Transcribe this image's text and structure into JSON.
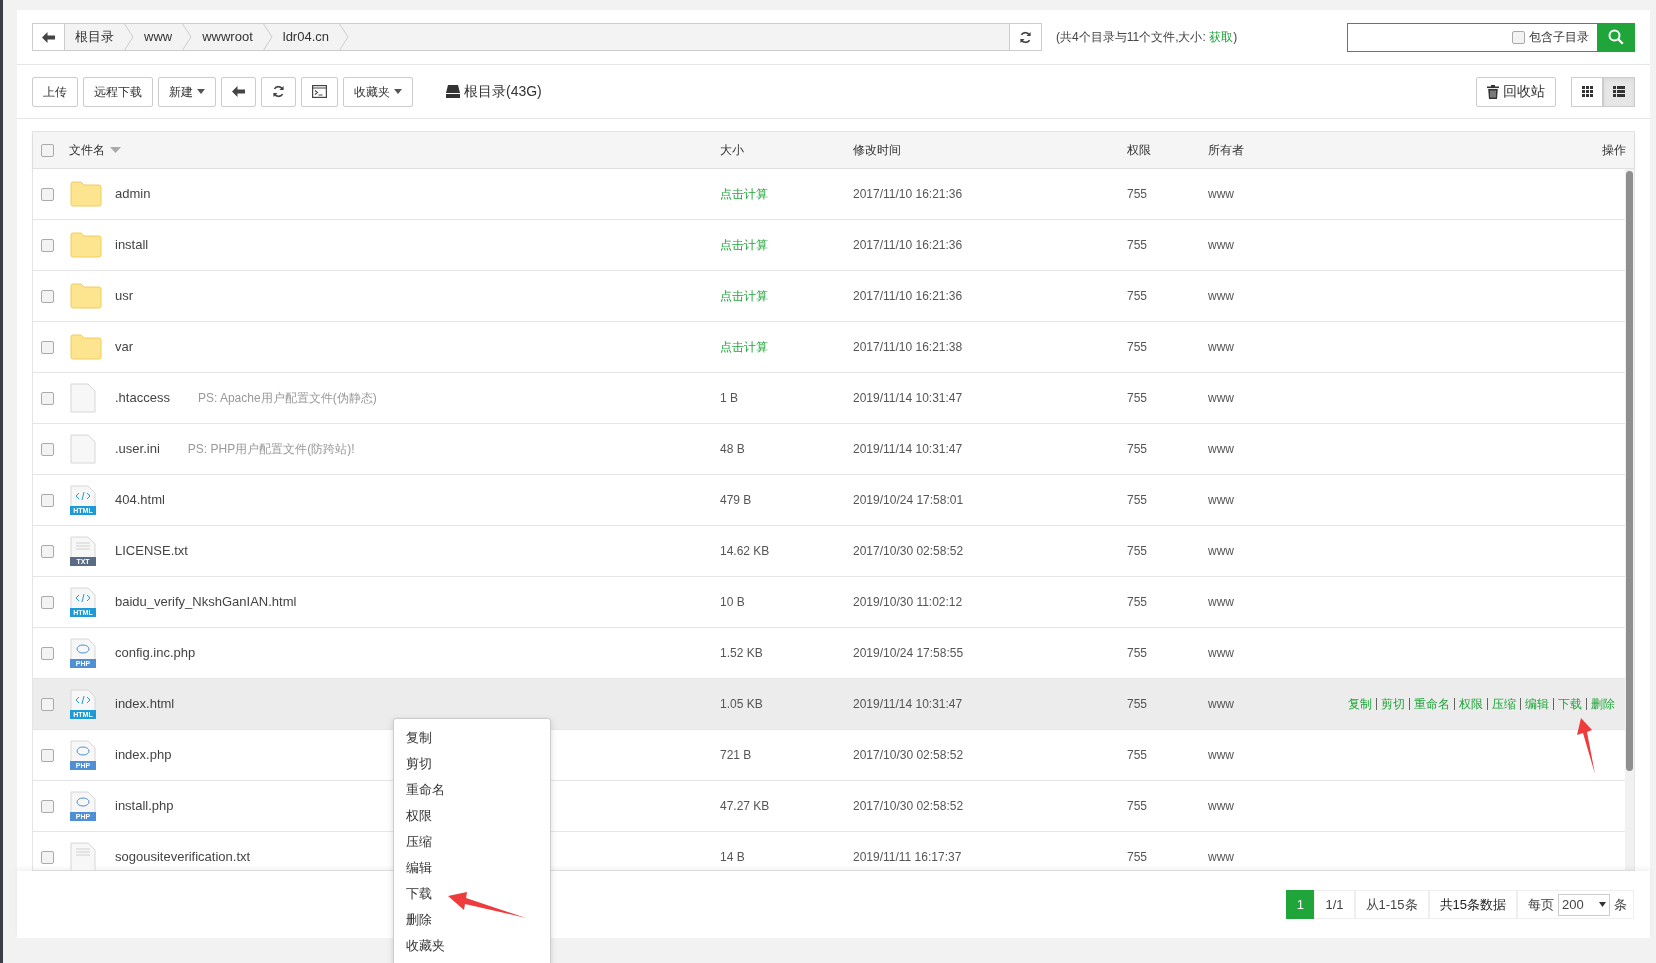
{
  "breadcrumb": {
    "items": [
      "根目录",
      "www",
      "wwwroot",
      "ldr04.cn"
    ]
  },
  "summary": {
    "text": "(共4个目录与11个文件,大小:",
    "link": "获取",
    "close": ")"
  },
  "search": {
    "include_subdirs": {
      "label": "包含子目录",
      "checked": false
    }
  },
  "toolbar": {
    "buttons": [
      {
        "kind": "text",
        "label": "上传"
      },
      {
        "kind": "text",
        "label": "远程下载"
      },
      {
        "kind": "dropdown",
        "label": "新建"
      },
      {
        "kind": "back"
      },
      {
        "kind": "refresh"
      },
      {
        "kind": "terminal"
      },
      {
        "kind": "dropdown",
        "label": "收藏夹"
      }
    ],
    "disk": "根目录(43G)",
    "recycle": "回收站",
    "views": [
      {
        "kind": "grid",
        "selected": false
      },
      {
        "kind": "list",
        "selected": true
      }
    ]
  },
  "table": {
    "select_all_checked": false,
    "columns": [
      "文件名",
      "大小",
      "修改时间",
      "权限",
      "所有者",
      "操作"
    ],
    "rows": [
      {
        "kind": "folder",
        "name": "admin",
        "size": "点击计算",
        "size_is_link": true,
        "modified": "2017/11/10 16:21:36",
        "perm": "755",
        "owner": "www",
        "checked": false,
        "highlighted": false
      },
      {
        "kind": "folder",
        "name": "install",
        "size": "点击计算",
        "size_is_link": true,
        "modified": "2017/11/10 16:21:36",
        "perm": "755",
        "owner": "www",
        "checked": false,
        "highlighted": false
      },
      {
        "kind": "folder",
        "name": "usr",
        "size": "点击计算",
        "size_is_link": true,
        "modified": "2017/11/10 16:21:36",
        "perm": "755",
        "owner": "www",
        "checked": false,
        "highlighted": false
      },
      {
        "kind": "folder",
        "name": "var",
        "size": "点击计算",
        "size_is_link": true,
        "modified": "2017/11/10 16:21:38",
        "perm": "755",
        "owner": "www",
        "checked": false,
        "highlighted": false
      },
      {
        "kind": "blank",
        "name": ".htaccess",
        "note": "PS: Apache用户配置文件(伪静态)",
        "size": "1 B",
        "size_is_link": false,
        "modified": "2019/11/14 10:31:47",
        "perm": "755",
        "owner": "www",
        "checked": false,
        "highlighted": false
      },
      {
        "kind": "blank",
        "name": ".user.ini",
        "note": "PS: PHP用户配置文件(防跨站)!",
        "size": "48 B",
        "size_is_link": false,
        "modified": "2019/11/14 10:31:47",
        "perm": "755",
        "owner": "www",
        "checked": false,
        "highlighted": false
      },
      {
        "kind": "html",
        "icon_label": "HTML",
        "name": "404.html",
        "size": "479 B",
        "size_is_link": false,
        "modified": "2019/10/24 17:58:01",
        "perm": "755",
        "owner": "www",
        "checked": false,
        "highlighted": false
      },
      {
        "kind": "txt",
        "icon_label": "TXT",
        "name": "LICENSE.txt",
        "size": "14.62 KB",
        "size_is_link": false,
        "modified": "2017/10/30 02:58:52",
        "perm": "755",
        "owner": "www",
        "checked": false,
        "highlighted": false
      },
      {
        "kind": "html",
        "icon_label": "HTML",
        "name": "baidu_verify_NkshGanIAN.html",
        "size": "10 B",
        "size_is_link": false,
        "modified": "2019/10/30 11:02:12",
        "perm": "755",
        "owner": "www",
        "checked": false,
        "highlighted": false
      },
      {
        "kind": "php",
        "icon_label": "PHP",
        "name": "config.inc.php",
        "size": "1.52 KB",
        "size_is_link": false,
        "modified": "2019/10/24 17:58:55",
        "perm": "755",
        "owner": "www",
        "checked": false,
        "highlighted": false
      },
      {
        "kind": "html",
        "icon_label": "HTML",
        "name": "index.html",
        "size": "1.05 KB",
        "size_is_link": false,
        "modified": "2019/11/14 10:31:47",
        "perm": "755",
        "owner": "www",
        "checked": false,
        "highlighted": true,
        "actions": [
          "复制",
          "剪切",
          "重命名",
          "权限",
          "压缩",
          "编辑",
          "下载",
          "删除"
        ]
      },
      {
        "kind": "php",
        "icon_label": "PHP",
        "name": "index.php",
        "size": "721 B",
        "size_is_link": false,
        "modified": "2017/10/30 02:58:52",
        "perm": "755",
        "owner": "www",
        "checked": false,
        "highlighted": false
      },
      {
        "kind": "php",
        "icon_label": "PHP",
        "name": "install.php",
        "size": "47.27 KB",
        "size_is_link": false,
        "modified": "2017/10/30 02:58:52",
        "perm": "755",
        "owner": "www",
        "checked": false,
        "highlighted": false
      },
      {
        "kind": "txt",
        "name": "sogousiteverification.txt",
        "size": "14 B",
        "size_is_link": false,
        "modified": "2019/11/11 16:17:37",
        "perm": "755",
        "owner": "www",
        "checked": false,
        "highlighted": false
      }
    ]
  },
  "pagination": {
    "pages": [
      {
        "label": "1",
        "selected": true
      }
    ],
    "page_info": "1/1",
    "range": "从1-15条",
    "total": "共15条数据",
    "per_page_label": "每页",
    "per_page": "200",
    "unit": "条"
  },
  "context_menu": {
    "items": [
      "复制",
      "剪切",
      "重命名",
      "权限",
      "压缩",
      "编辑",
      "下载",
      "删除",
      "收藏夹"
    ]
  }
}
